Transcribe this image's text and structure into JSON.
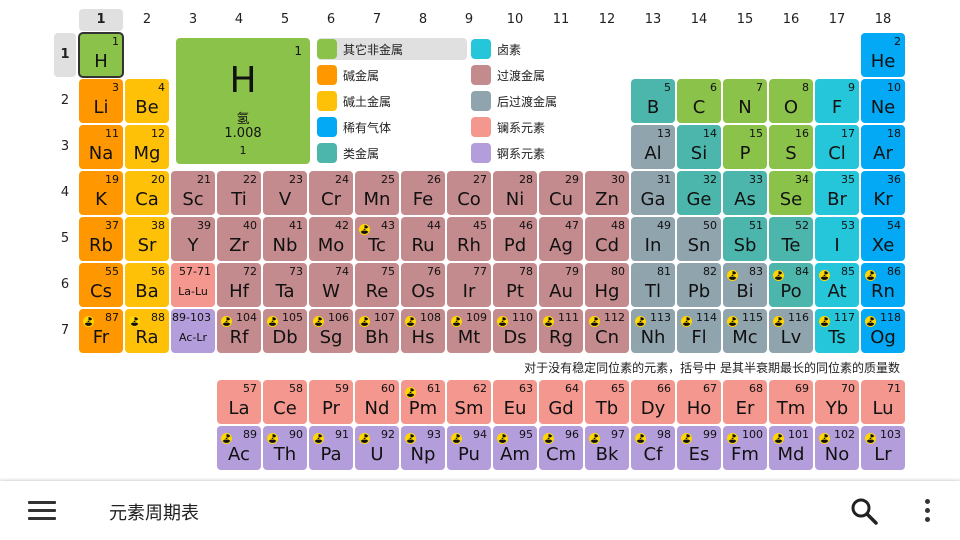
{
  "columns": [
    "1",
    "2",
    "3",
    "4",
    "5",
    "6",
    "7",
    "8",
    "9",
    "10",
    "11",
    "12",
    "13",
    "14",
    "15",
    "16",
    "17",
    "18"
  ],
  "rows": [
    "1",
    "2",
    "3",
    "4",
    "5",
    "6",
    "7"
  ],
  "selected_element": {
    "num": "1",
    "sym": "H",
    "name": "氢",
    "mass": "1.008",
    "group": "1"
  },
  "legend": [
    {
      "label": "其它非金属",
      "color": "#8bc34a",
      "active": true
    },
    {
      "label": "碱金属",
      "color": "#ff9800"
    },
    {
      "label": "碱土金属",
      "color": "#ffc107"
    },
    {
      "label": "稀有气体",
      "color": "#03a9f4"
    },
    {
      "label": "类金属",
      "color": "#4db6ac"
    },
    {
      "label": "卤素",
      "color": "#26c6da"
    },
    {
      "label": "过渡金属",
      "color": "#c48b8e"
    },
    {
      "label": "后过渡金属",
      "color": "#90a4ae"
    },
    {
      "label": "镧系元素",
      "color": "#f4978e"
    },
    {
      "label": "锕系元素",
      "color": "#b39ddb"
    }
  ],
  "elements": [
    {
      "n": "1",
      "s": "H",
      "r": 1,
      "c": 1,
      "cat": 0
    },
    {
      "n": "2",
      "s": "He",
      "r": 1,
      "c": 18,
      "cat": 3
    },
    {
      "n": "3",
      "s": "Li",
      "r": 2,
      "c": 1,
      "cat": 1
    },
    {
      "n": "4",
      "s": "Be",
      "r": 2,
      "c": 2,
      "cat": 2
    },
    {
      "n": "5",
      "s": "B",
      "r": 2,
      "c": 13,
      "cat": 4
    },
    {
      "n": "6",
      "s": "C",
      "r": 2,
      "c": 14,
      "cat": 0
    },
    {
      "n": "7",
      "s": "N",
      "r": 2,
      "c": 15,
      "cat": 0
    },
    {
      "n": "8",
      "s": "O",
      "r": 2,
      "c": 16,
      "cat": 0
    },
    {
      "n": "9",
      "s": "F",
      "r": 2,
      "c": 17,
      "cat": 5
    },
    {
      "n": "10",
      "s": "Ne",
      "r": 2,
      "c": 18,
      "cat": 3
    },
    {
      "n": "11",
      "s": "Na",
      "r": 3,
      "c": 1,
      "cat": 1
    },
    {
      "n": "12",
      "s": "Mg",
      "r": 3,
      "c": 2,
      "cat": 2
    },
    {
      "n": "13",
      "s": "Al",
      "r": 3,
      "c": 13,
      "cat": 7
    },
    {
      "n": "14",
      "s": "Si",
      "r": 3,
      "c": 14,
      "cat": 4
    },
    {
      "n": "15",
      "s": "P",
      "r": 3,
      "c": 15,
      "cat": 0
    },
    {
      "n": "16",
      "s": "S",
      "r": 3,
      "c": 16,
      "cat": 0
    },
    {
      "n": "17",
      "s": "Cl",
      "r": 3,
      "c": 17,
      "cat": 5
    },
    {
      "n": "18",
      "s": "Ar",
      "r": 3,
      "c": 18,
      "cat": 3
    },
    {
      "n": "19",
      "s": "K",
      "r": 4,
      "c": 1,
      "cat": 1
    },
    {
      "n": "20",
      "s": "Ca",
      "r": 4,
      "c": 2,
      "cat": 2
    },
    {
      "n": "21",
      "s": "Sc",
      "r": 4,
      "c": 3,
      "cat": 6
    },
    {
      "n": "22",
      "s": "Ti",
      "r": 4,
      "c": 4,
      "cat": 6
    },
    {
      "n": "23",
      "s": "V",
      "r": 4,
      "c": 5,
      "cat": 6
    },
    {
      "n": "24",
      "s": "Cr",
      "r": 4,
      "c": 6,
      "cat": 6
    },
    {
      "n": "25",
      "s": "Mn",
      "r": 4,
      "c": 7,
      "cat": 6
    },
    {
      "n": "26",
      "s": "Fe",
      "r": 4,
      "c": 8,
      "cat": 6
    },
    {
      "n": "27",
      "s": "Co",
      "r": 4,
      "c": 9,
      "cat": 6
    },
    {
      "n": "28",
      "s": "Ni",
      "r": 4,
      "c": 10,
      "cat": 6
    },
    {
      "n": "29",
      "s": "Cu",
      "r": 4,
      "c": 11,
      "cat": 6
    },
    {
      "n": "30",
      "s": "Zn",
      "r": 4,
      "c": 12,
      "cat": 6
    },
    {
      "n": "31",
      "s": "Ga",
      "r": 4,
      "c": 13,
      "cat": 7
    },
    {
      "n": "32",
      "s": "Ge",
      "r": 4,
      "c": 14,
      "cat": 4
    },
    {
      "n": "33",
      "s": "As",
      "r": 4,
      "c": 15,
      "cat": 4
    },
    {
      "n": "34",
      "s": "Se",
      "r": 4,
      "c": 16,
      "cat": 0
    },
    {
      "n": "35",
      "s": "Br",
      "r": 4,
      "c": 17,
      "cat": 5
    },
    {
      "n": "36",
      "s": "Kr",
      "r": 4,
      "c": 18,
      "cat": 3
    },
    {
      "n": "37",
      "s": "Rb",
      "r": 5,
      "c": 1,
      "cat": 1
    },
    {
      "n": "38",
      "s": "Sr",
      "r": 5,
      "c": 2,
      "cat": 2
    },
    {
      "n": "39",
      "s": "Y",
      "r": 5,
      "c": 3,
      "cat": 6
    },
    {
      "n": "40",
      "s": "Zr",
      "r": 5,
      "c": 4,
      "cat": 6
    },
    {
      "n": "41",
      "s": "Nb",
      "r": 5,
      "c": 5,
      "cat": 6
    },
    {
      "n": "42",
      "s": "Mo",
      "r": 5,
      "c": 6,
      "cat": 6
    },
    {
      "n": "43",
      "s": "Tc",
      "r": 5,
      "c": 7,
      "cat": 6,
      "rad": true
    },
    {
      "n": "44",
      "s": "Ru",
      "r": 5,
      "c": 8,
      "cat": 6
    },
    {
      "n": "45",
      "s": "Rh",
      "r": 5,
      "c": 9,
      "cat": 6
    },
    {
      "n": "46",
      "s": "Pd",
      "r": 5,
      "c": 10,
      "cat": 6
    },
    {
      "n": "47",
      "s": "Ag",
      "r": 5,
      "c": 11,
      "cat": 6
    },
    {
      "n": "48",
      "s": "Cd",
      "r": 5,
      "c": 12,
      "cat": 6
    },
    {
      "n": "49",
      "s": "In",
      "r": 5,
      "c": 13,
      "cat": 7
    },
    {
      "n": "50",
      "s": "Sn",
      "r": 5,
      "c": 14,
      "cat": 7
    },
    {
      "n": "51",
      "s": "Sb",
      "r": 5,
      "c": 15,
      "cat": 4
    },
    {
      "n": "52",
      "s": "Te",
      "r": 5,
      "c": 16,
      "cat": 4
    },
    {
      "n": "53",
      "s": "I",
      "r": 5,
      "c": 17,
      "cat": 5
    },
    {
      "n": "54",
      "s": "Xe",
      "r": 5,
      "c": 18,
      "cat": 3
    },
    {
      "n": "55",
      "s": "Cs",
      "r": 6,
      "c": 1,
      "cat": 1
    },
    {
      "n": "56",
      "s": "Ba",
      "r": 6,
      "c": 2,
      "cat": 2
    },
    {
      "n": "57-71",
      "s": "La-Lu",
      "r": 6,
      "c": 3,
      "cat": 8,
      "small": true
    },
    {
      "n": "72",
      "s": "Hf",
      "r": 6,
      "c": 4,
      "cat": 6
    },
    {
      "n": "73",
      "s": "Ta",
      "r": 6,
      "c": 5,
      "cat": 6
    },
    {
      "n": "74",
      "s": "W",
      "r": 6,
      "c": 6,
      "cat": 6
    },
    {
      "n": "75",
      "s": "Re",
      "r": 6,
      "c": 7,
      "cat": 6
    },
    {
      "n": "76",
      "s": "Os",
      "r": 6,
      "c": 8,
      "cat": 6
    },
    {
      "n": "77",
      "s": "Ir",
      "r": 6,
      "c": 9,
      "cat": 6
    },
    {
      "n": "78",
      "s": "Pt",
      "r": 6,
      "c": 10,
      "cat": 6
    },
    {
      "n": "79",
      "s": "Au",
      "r": 6,
      "c": 11,
      "cat": 6
    },
    {
      "n": "80",
      "s": "Hg",
      "r": 6,
      "c": 12,
      "cat": 6
    },
    {
      "n": "81",
      "s": "Tl",
      "r": 6,
      "c": 13,
      "cat": 7
    },
    {
      "n": "82",
      "s": "Pb",
      "r": 6,
      "c": 14,
      "cat": 7
    },
    {
      "n": "83",
      "s": "Bi",
      "r": 6,
      "c": 15,
      "cat": 7,
      "rad": true
    },
    {
      "n": "84",
      "s": "Po",
      "r": 6,
      "c": 16,
      "cat": 4,
      "rad": true
    },
    {
      "n": "85",
      "s": "At",
      "r": 6,
      "c": 17,
      "cat": 5,
      "rad": true
    },
    {
      "n": "86",
      "s": "Rn",
      "r": 6,
      "c": 18,
      "cat": 3,
      "rad": true
    },
    {
      "n": "87",
      "s": "Fr",
      "r": 7,
      "c": 1,
      "cat": 1,
      "rad": true
    },
    {
      "n": "88",
      "s": "Ra",
      "r": 7,
      "c": 2,
      "cat": 2,
      "rad": true
    },
    {
      "n": "89-103",
      "s": "Ac-Lr",
      "r": 7,
      "c": 3,
      "cat": 9,
      "small": true
    },
    {
      "n": "104",
      "s": "Rf",
      "r": 7,
      "c": 4,
      "cat": 6,
      "rad": true
    },
    {
      "n": "105",
      "s": "Db",
      "r": 7,
      "c": 5,
      "cat": 6,
      "rad": true
    },
    {
      "n": "106",
      "s": "Sg",
      "r": 7,
      "c": 6,
      "cat": 6,
      "rad": true
    },
    {
      "n": "107",
      "s": "Bh",
      "r": 7,
      "c": 7,
      "cat": 6,
      "rad": true
    },
    {
      "n": "108",
      "s": "Hs",
      "r": 7,
      "c": 8,
      "cat": 6,
      "rad": true
    },
    {
      "n": "109",
      "s": "Mt",
      "r": 7,
      "c": 9,
      "cat": 6,
      "rad": true
    },
    {
      "n": "110",
      "s": "Ds",
      "r": 7,
      "c": 10,
      "cat": 6,
      "rad": true
    },
    {
      "n": "111",
      "s": "Rg",
      "r": 7,
      "c": 11,
      "cat": 6,
      "rad": true
    },
    {
      "n": "112",
      "s": "Cn",
      "r": 7,
      "c": 12,
      "cat": 6,
      "rad": true
    },
    {
      "n": "113",
      "s": "Nh",
      "r": 7,
      "c": 13,
      "cat": 7,
      "rad": true
    },
    {
      "n": "114",
      "s": "Fl",
      "r": 7,
      "c": 14,
      "cat": 7,
      "rad": true
    },
    {
      "n": "115",
      "s": "Mc",
      "r": 7,
      "c": 15,
      "cat": 7,
      "rad": true
    },
    {
      "n": "116",
      "s": "Lv",
      "r": 7,
      "c": 16,
      "cat": 7,
      "rad": true
    },
    {
      "n": "117",
      "s": "Ts",
      "r": 7,
      "c": 17,
      "cat": 5,
      "rad": true
    },
    {
      "n": "118",
      "s": "Og",
      "r": 7,
      "c": 18,
      "cat": 3,
      "rad": true
    },
    {
      "n": "57",
      "s": "La",
      "r": 9,
      "c": 4,
      "cat": 8
    },
    {
      "n": "58",
      "s": "Ce",
      "r": 9,
      "c": 5,
      "cat": 8
    },
    {
      "n": "59",
      "s": "Pr",
      "r": 9,
      "c": 6,
      "cat": 8
    },
    {
      "n": "60",
      "s": "Nd",
      "r": 9,
      "c": 7,
      "cat": 8
    },
    {
      "n": "61",
      "s": "Pm",
      "r": 9,
      "c": 8,
      "cat": 8,
      "rad": true
    },
    {
      "n": "62",
      "s": "Sm",
      "r": 9,
      "c": 9,
      "cat": 8
    },
    {
      "n": "63",
      "s": "Eu",
      "r": 9,
      "c": 10,
      "cat": 8
    },
    {
      "n": "64",
      "s": "Gd",
      "r": 9,
      "c": 11,
      "cat": 8
    },
    {
      "n": "65",
      "s": "Tb",
      "r": 9,
      "c": 12,
      "cat": 8
    },
    {
      "n": "66",
      "s": "Dy",
      "r": 9,
      "c": 13,
      "cat": 8
    },
    {
      "n": "67",
      "s": "Ho",
      "r": 9,
      "c": 14,
      "cat": 8
    },
    {
      "n": "68",
      "s": "Er",
      "r": 9,
      "c": 15,
      "cat": 8
    },
    {
      "n": "69",
      "s": "Tm",
      "r": 9,
      "c": 16,
      "cat": 8
    },
    {
      "n": "70",
      "s": "Yb",
      "r": 9,
      "c": 17,
      "cat": 8
    },
    {
      "n": "71",
      "s": "Lu",
      "r": 9,
      "c": 18,
      "cat": 8
    },
    {
      "n": "89",
      "s": "Ac",
      "r": 10,
      "c": 4,
      "cat": 9,
      "rad": true
    },
    {
      "n": "90",
      "s": "Th",
      "r": 10,
      "c": 5,
      "cat": 9,
      "rad": true
    },
    {
      "n": "91",
      "s": "Pa",
      "r": 10,
      "c": 6,
      "cat": 9,
      "rad": true
    },
    {
      "n": "92",
      "s": "U",
      "r": 10,
      "c": 7,
      "cat": 9,
      "rad": true
    },
    {
      "n": "93",
      "s": "Np",
      "r": 10,
      "c": 8,
      "cat": 9,
      "rad": true
    },
    {
      "n": "94",
      "s": "Pu",
      "r": 10,
      "c": 9,
      "cat": 9,
      "rad": true
    },
    {
      "n": "95",
      "s": "Am",
      "r": 10,
      "c": 10,
      "cat": 9,
      "rad": true
    },
    {
      "n": "96",
      "s": "Cm",
      "r": 10,
      "c": 11,
      "cat": 9,
      "rad": true
    },
    {
      "n": "97",
      "s": "Bk",
      "r": 10,
      "c": 12,
      "cat": 9,
      "rad": true
    },
    {
      "n": "98",
      "s": "Cf",
      "r": 10,
      "c": 13,
      "cat": 9,
      "rad": true
    },
    {
      "n": "99",
      "s": "Es",
      "r": 10,
      "c": 14,
      "cat": 9,
      "rad": true
    },
    {
      "n": "100",
      "s": "Fm",
      "r": 10,
      "c": 15,
      "cat": 9,
      "rad": true
    },
    {
      "n": "101",
      "s": "Md",
      "r": 10,
      "c": 16,
      "cat": 9,
      "rad": true
    },
    {
      "n": "102",
      "s": "No",
      "r": 10,
      "c": 17,
      "cat": 9,
      "rad": true
    },
    {
      "n": "103",
      "s": "Lr",
      "r": 10,
      "c": 18,
      "cat": 9,
      "rad": true
    }
  ],
  "note": "对于没有稳定同位素的元素，括号中 是其半衰期最长的同位素的质量数",
  "appbar": {
    "title": "元素周期表",
    "icons": [
      "menu-icon",
      "search-icon",
      "more-vert-icon"
    ]
  },
  "colors": {
    "radiation_bg": "#ffd600",
    "selected_header_bg": "#e0e0e0"
  }
}
